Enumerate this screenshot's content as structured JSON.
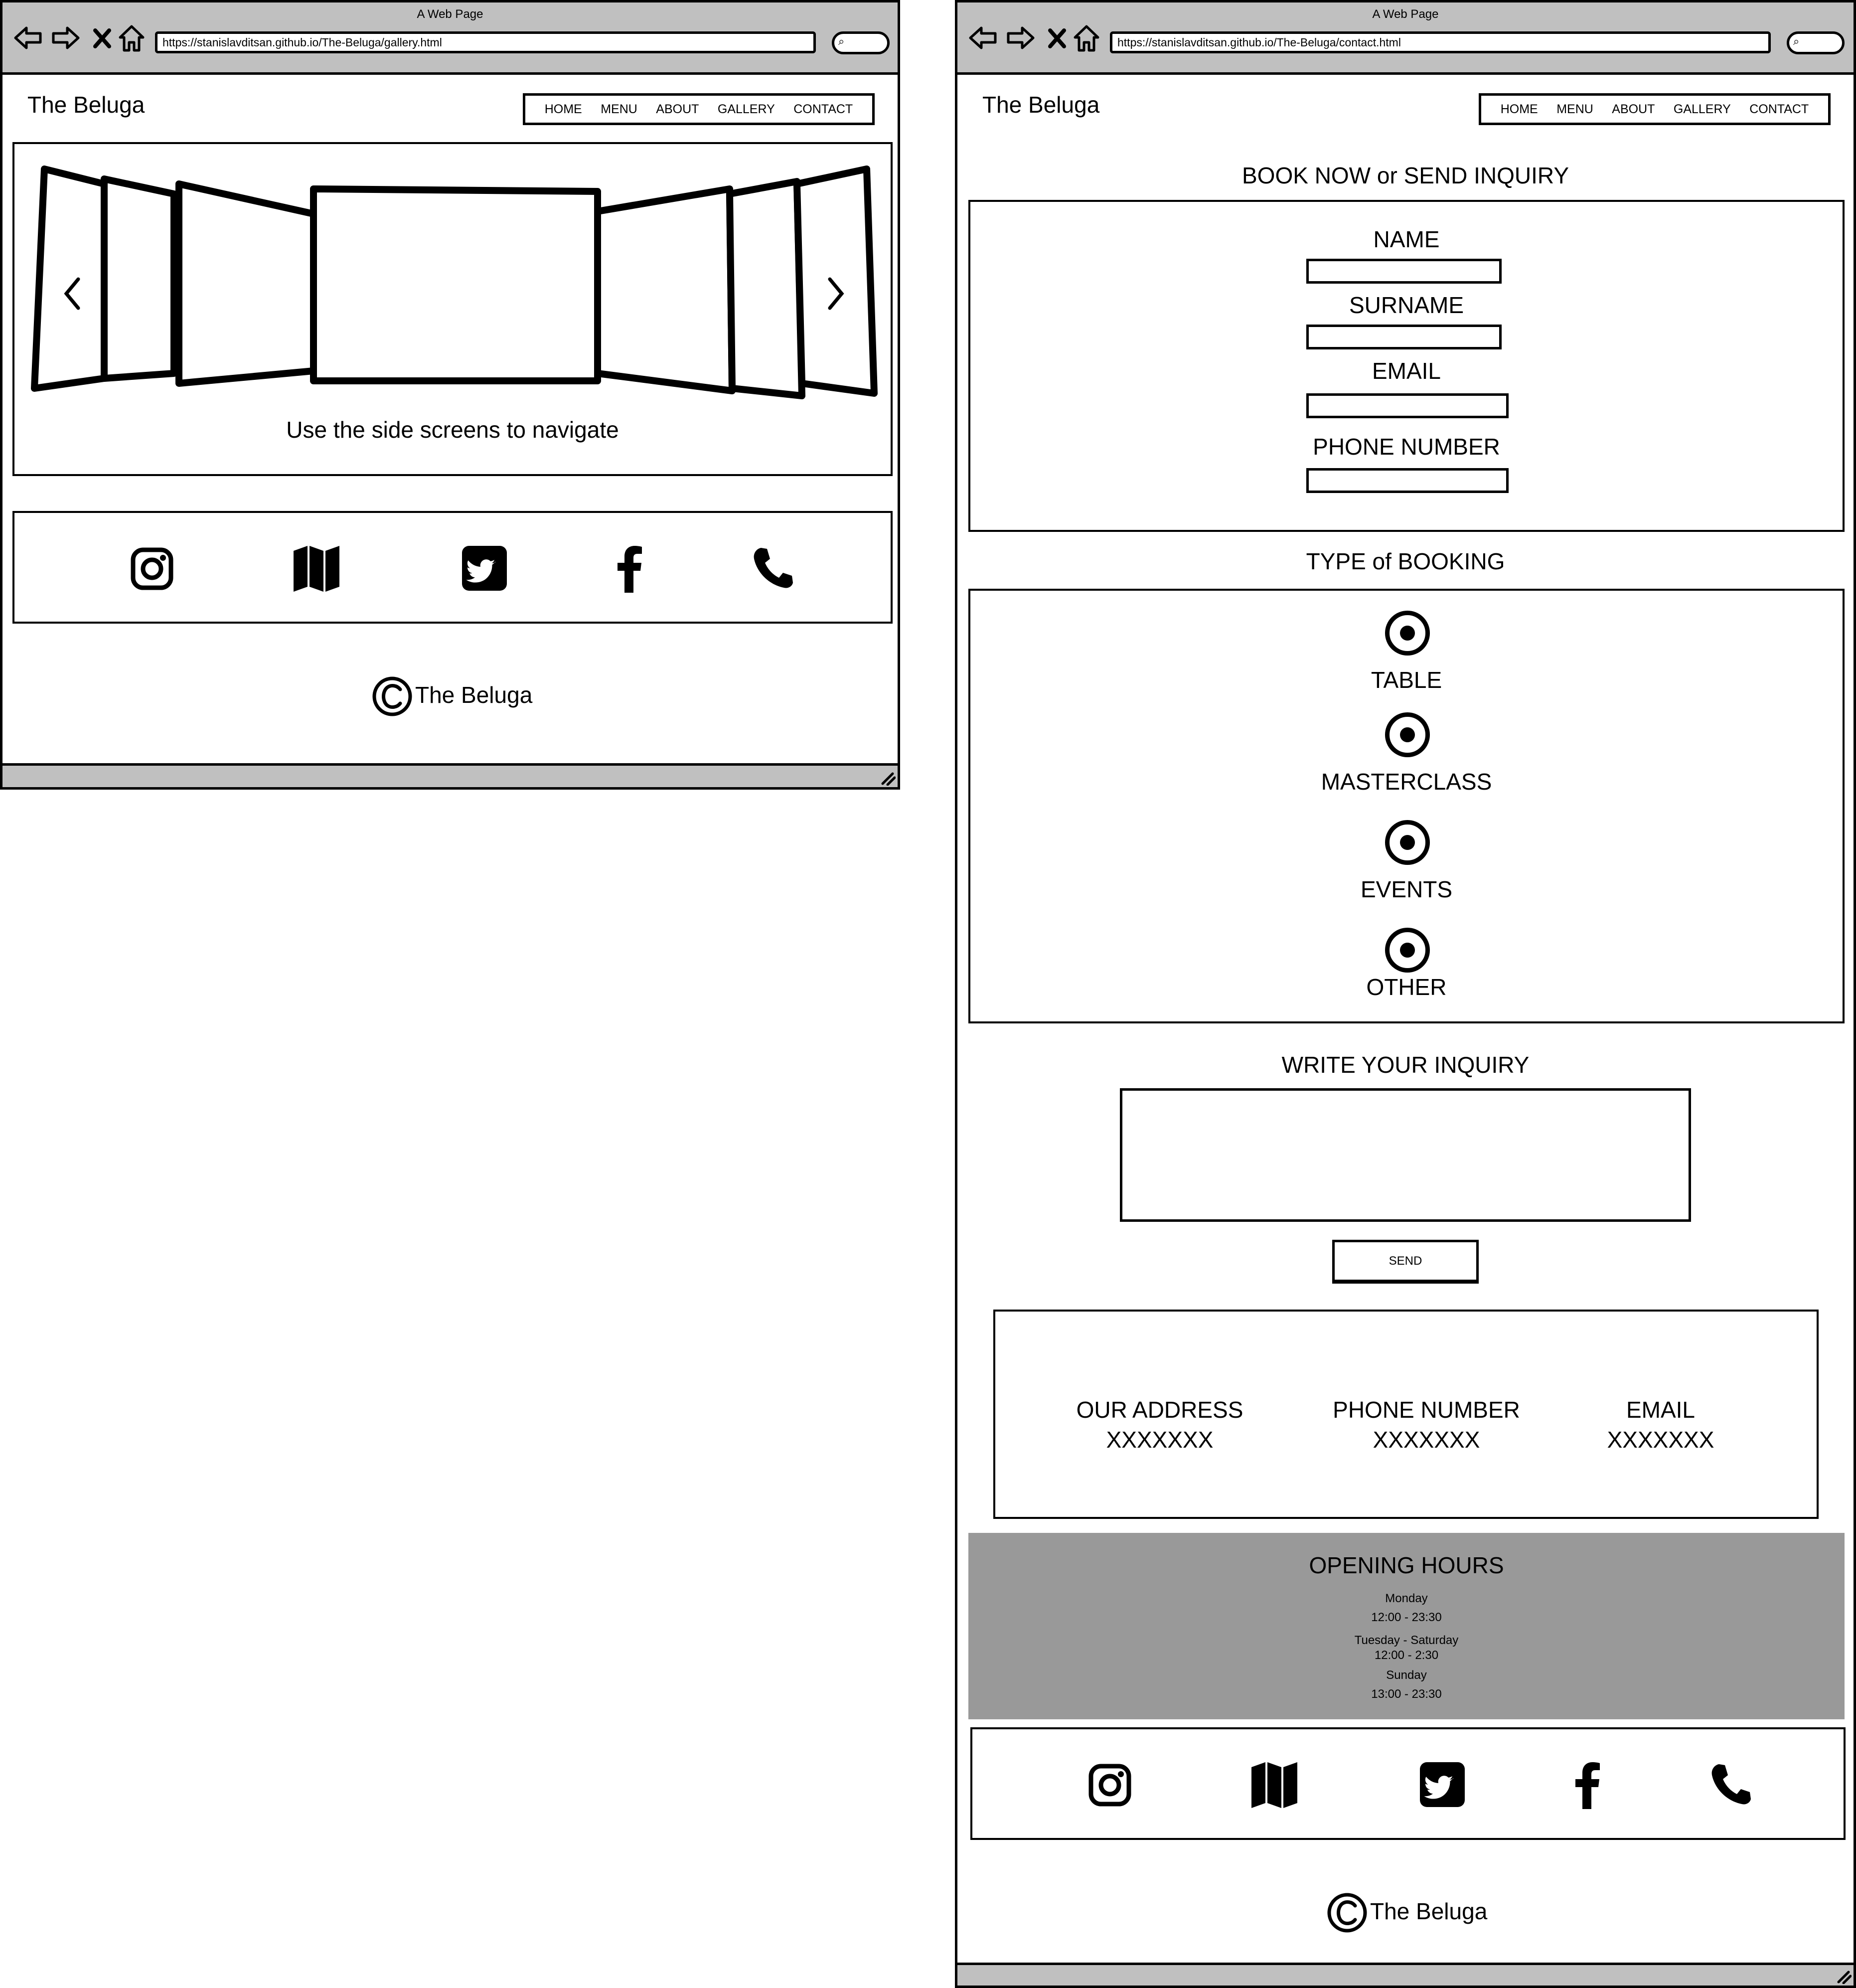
{
  "left": {
    "window_title": "A Web Page",
    "url": "https://stanislavditsan.github.io/The-Beluga/gallery.html",
    "brand": "The Beluga",
    "nav": [
      "HOME",
      "MENU",
      "ABOUT",
      "GALLERY",
      "CONTACT"
    ],
    "carousel_caption": "Use the side screens to navigate",
    "footer": "The Beluga"
  },
  "right": {
    "window_title": "A Web Page",
    "url": "https://stanislavditsan.github.io/The-Beluga/contact.html",
    "brand": "The Beluga",
    "nav": [
      "HOME",
      "MENU",
      "ABOUT",
      "GALLERY",
      "CONTACT"
    ],
    "form_title": "BOOK NOW or SEND INQUIRY",
    "fields": [
      "NAME",
      "SURNAME",
      "EMAIL",
      "PHONE NUMBER"
    ],
    "booking_title": "TYPE of BOOKING",
    "booking_options": [
      "TABLE",
      "MASTERCLASS",
      "EVENTS",
      "OTHER"
    ],
    "inquiry_title": "WRITE YOUR INQUIRY",
    "send_label": "SEND",
    "contact": [
      {
        "label": "OUR ADDRESS",
        "value": "XXXXXXX"
      },
      {
        "label": "PHONE NUMBER",
        "value": "XXXXXXX"
      },
      {
        "label": "EMAIL",
        "value": "XXXXXXX"
      }
    ],
    "hours_title": "OPENING HOURS",
    "hours": [
      "Monday",
      "12:00 - 23:30",
      "Tuesday - Saturday",
      "12:00 - 2:30",
      "Sunday",
      "13:00 - 23:30"
    ],
    "footer": "The Beluga"
  },
  "social_icons": [
    "instagram-icon",
    "map-icon",
    "twitter-icon",
    "facebook-icon",
    "phone-icon"
  ]
}
